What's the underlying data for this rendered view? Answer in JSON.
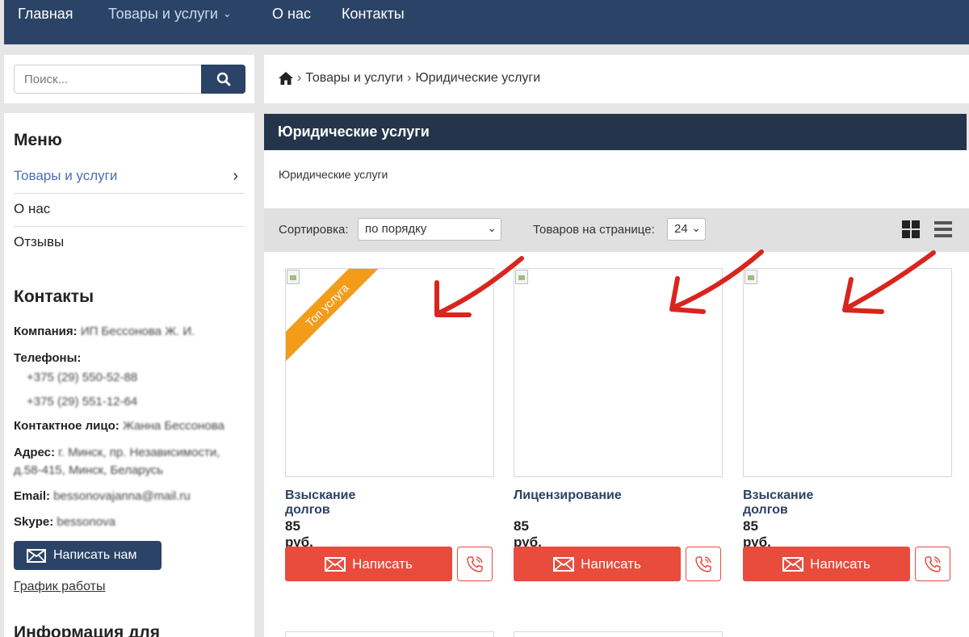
{
  "nav": {
    "items": [
      {
        "label": "Главная"
      },
      {
        "label": "Товары и услуги"
      },
      {
        "label": "О нас"
      },
      {
        "label": "Контакты"
      }
    ]
  },
  "search": {
    "placeholder": "Поиск..."
  },
  "sidebar": {
    "menu_heading": "Меню",
    "menu": [
      {
        "label": "Товары и услуги"
      },
      {
        "label": "О нас"
      },
      {
        "label": "Отзывы"
      }
    ],
    "contacts_heading": "Контакты",
    "contacts": {
      "company_label": "Компания:",
      "company_value": "ИП Бессонова Ж. И.",
      "phones_label": "Телефоны:",
      "phone1": "+375 (29) 550-52-88",
      "phone2": "+375 (29) 551-12-64",
      "person_label": "Контактное лицо:",
      "person_value": "Жанна Бессонова",
      "address_label": "Адрес:",
      "address_value": "г. Минск, пр. Независимости,",
      "address_value2": "д.58-415, Минск, Беларусь",
      "email_label": "Email:",
      "email_value": "bessonovajanna@mail.ru",
      "skype_label": "Skype:",
      "skype_value": "bessonova"
    },
    "write_button": "Написать нам",
    "schedule_link": "График работы",
    "info_heading": "Информация для"
  },
  "breadcrumb": {
    "items": [
      "Товары и услуги",
      "Юридические услуги"
    ],
    "separator": "›"
  },
  "category": {
    "title": "Юридические услуги",
    "description": "Юридические услуги"
  },
  "toolbar": {
    "sort_label": "Сортировка:",
    "sort_value": "по порядку",
    "per_page_label": "Товаров на странице:",
    "per_page_value": "24"
  },
  "products": [
    {
      "title": "Взыскание долгов",
      "price": "85 руб.",
      "badge": "Топ услуга",
      "button": "Написать"
    },
    {
      "title": "Лицензирование",
      "price": "85 руб.",
      "badge": "",
      "button": "Написать"
    },
    {
      "title": "Взыскание долгов",
      "price": "85 руб.",
      "badge": "",
      "button": "Написать"
    }
  ],
  "colors": {
    "nav_bg": "#2b4366",
    "header_bg": "#24344a",
    "accent_red": "#e84c3d",
    "ribbon": "#f39c1a",
    "link": "#2b4366",
    "annotation_arrow": "#d8251d"
  },
  "icons": {
    "home": "home-icon",
    "search": "search-icon",
    "grid_view": "grid-view-icon",
    "list_view": "list-view-icon",
    "mail": "mail-icon",
    "phone": "phone-icon"
  }
}
